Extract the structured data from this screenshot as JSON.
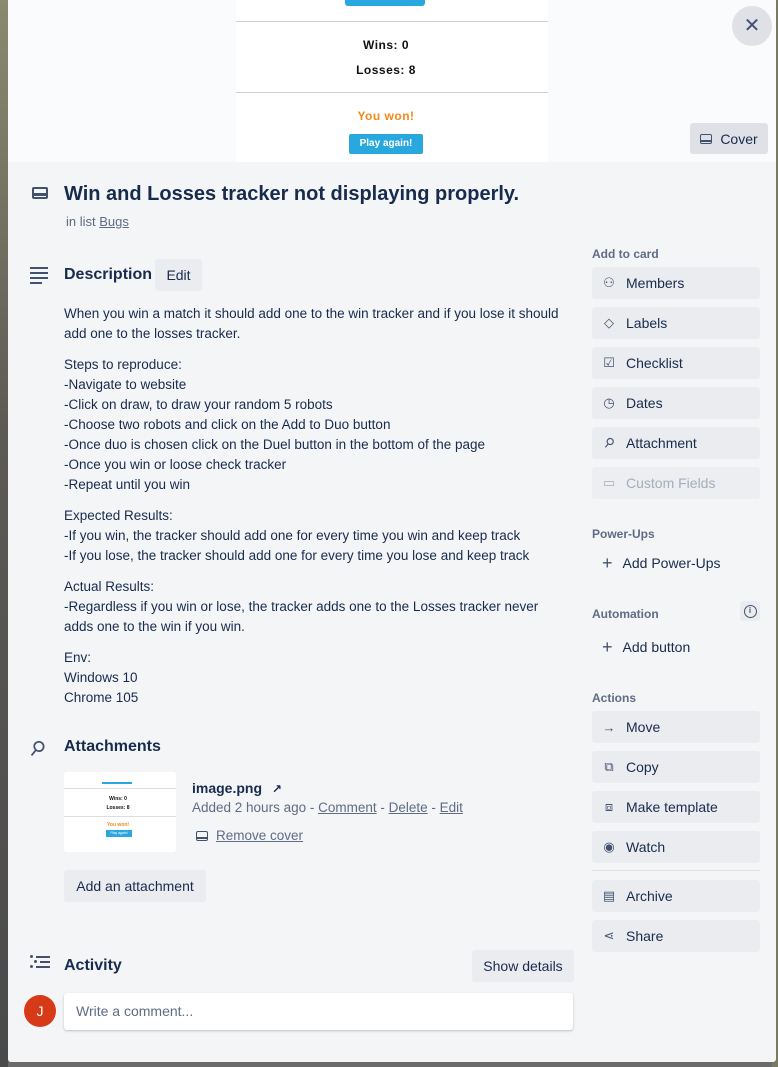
{
  "cover": {
    "wins": "Wins: 0",
    "losses": "Losses: 8",
    "result": "You won!",
    "play_again": "Play again!",
    "cover_button": "Cover"
  },
  "card": {
    "title": "Win and Losses tracker not displaying properly.",
    "in_list_prefix": "in list",
    "list_name": "Bugs"
  },
  "description": {
    "heading": "Description",
    "edit_label": "Edit",
    "paragraphs": [
      [
        "When you win a match it should add one to the win tracker and if you lose it should add one to the losses tracker."
      ],
      [
        "Steps to reproduce:",
        "-Navigate to website",
        "-Click on draw, to draw your random 5 robots",
        "-Choose two robots and click on the Add to Duo button",
        "-Once duo is chosen click on the Duel button in the bottom of the page",
        "-Once you win or loose check tracker",
        "-Repeat until you win"
      ],
      [
        "Expected Results:",
        "-If you win, the tracker should add one for every time you win and keep track",
        "-If you lose, the tracker should add one for every time you lose and keep track"
      ],
      [
        "Actual Results:",
        "-Regardless if you win or lose, the tracker adds one to the Losses tracker never adds one to the win if you win."
      ],
      [
        "Env:",
        "Windows 10",
        "Chrome 105"
      ]
    ]
  },
  "attachments": {
    "heading": "Attachments",
    "thumb": {
      "wins": "Wins: 0",
      "losses": "Losses: 8",
      "result": "You won!",
      "play_again": "Play again!"
    },
    "file_name": "image.png",
    "added": "Added 2 hours ago",
    "sep": " - ",
    "comment": "Comment",
    "delete": "Delete",
    "edit": "Edit",
    "remove_cover": "Remove cover",
    "add_label": "Add an attachment"
  },
  "activity": {
    "heading": "Activity",
    "show_details": "Show details",
    "avatar_initial": "J",
    "comment_placeholder": "Write a comment..."
  },
  "sidebar": {
    "add_to_card": "Add to card",
    "add_items": [
      "Members",
      "Labels",
      "Checklist",
      "Dates",
      "Attachment",
      "Custom Fields"
    ],
    "power_ups": "Power-Ups",
    "add_power_ups": "Add Power-Ups",
    "automation": "Automation",
    "add_button": "Add button",
    "actions": "Actions",
    "action_items": [
      "Move",
      "Copy",
      "Make template",
      "Watch",
      "Archive",
      "Share"
    ]
  },
  "colors": {
    "accent_blue": "#29a8e0",
    "won_orange": "#f08a18",
    "avatar_red": "#d73a16"
  }
}
